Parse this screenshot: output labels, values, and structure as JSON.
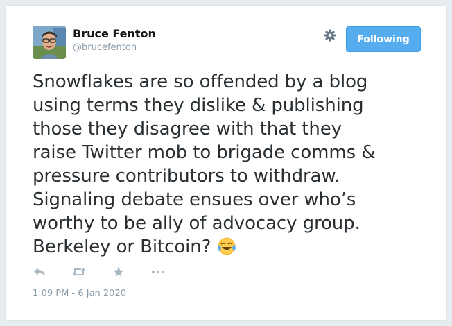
{
  "author": {
    "name": "Bruce Fenton",
    "handle": "@brucefenton"
  },
  "follow_button": {
    "label": "Following"
  },
  "tweet": {
    "text": "Snowflakes are so offended by a blog\nusing terms they dislike & publishing\nthose they disagree with that they\nraise Twitter mob to brigade comms &\npressure contributors to withdraw.\nSignaling debate ensues over who’s\nworthy to be ally of advocacy group.\nBerkeley or Bitcoin? ",
    "emoji": "face-with-tears-of-joy"
  },
  "actions": [
    "reply-icon",
    "retweet-icon",
    "like-icon",
    "more-icon"
  ],
  "timestamp": "1:09 PM - 6 Jan 2020",
  "colors": {
    "accent": "#55acee",
    "text": "#292f33",
    "muted": "#8899a6",
    "action_icon": "#aab8c2"
  }
}
